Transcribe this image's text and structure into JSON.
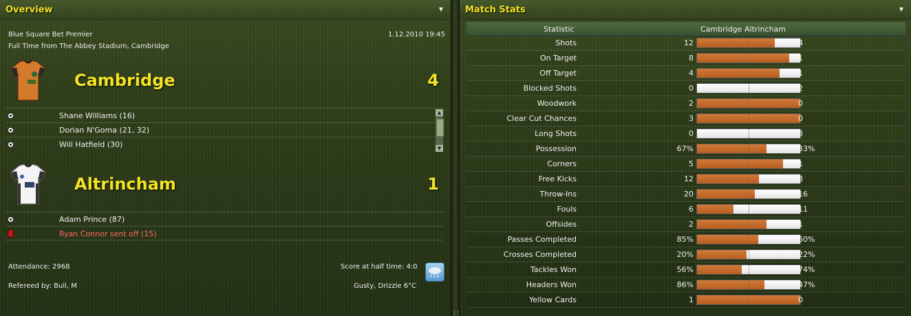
{
  "overview": {
    "title": "Overview",
    "competition": "Blue Square Bet Premier",
    "date_time": "1.12.2010 19:45",
    "venue": "Full Time from The Abbey Stadium, Cambridge",
    "home": {
      "name": "Cambridge",
      "score": "4",
      "events": [
        {
          "icon": "ball-icon",
          "text": "Shane Williams (16)"
        },
        {
          "icon": "ball-icon",
          "text": "Dorian N'Goma (21, 32)"
        },
        {
          "icon": "ball-icon",
          "text": "Will Hatfield (30)"
        }
      ]
    },
    "away": {
      "name": "Altrincham",
      "score": "1",
      "events": [
        {
          "icon": "ball-icon",
          "text": "Adam Prince (87)"
        },
        {
          "icon": "red-card-icon",
          "text": "Ryan Connor sent off (15)"
        }
      ]
    },
    "attendance": "Attendance: 2968",
    "referee": "Refereed by: Bull, M",
    "half_time": "Score at half time: 4:0",
    "weather": "Gusty, Drizzle 6°C"
  },
  "match_stats": {
    "title": "Match Stats",
    "header": {
      "statistic": "Statistic",
      "home": "Cambridge",
      "away": "Altrincham"
    },
    "colors": {
      "home": "#c26a2c",
      "away": "#f2f2f2"
    },
    "rows": [
      {
        "label": "Shots",
        "home": "12",
        "away": "4",
        "home_share": 0.75
      },
      {
        "label": "On Target",
        "home": "8",
        "away": "1",
        "home_share": 0.89
      },
      {
        "label": "Off Target",
        "home": "4",
        "away": "1",
        "home_share": 0.8
      },
      {
        "label": "Blocked Shots",
        "home": "0",
        "away": "2",
        "home_share": 0.0
      },
      {
        "label": "Woodwork",
        "home": "2",
        "away": "0",
        "home_share": 1.0
      },
      {
        "label": "Clear Cut Chances",
        "home": "3",
        "away": "0",
        "home_share": 1.0
      },
      {
        "label": "Long Shots",
        "home": "0",
        "away": "3",
        "home_share": 0.0
      },
      {
        "label": "Possession",
        "home": "67%",
        "away": "33%",
        "home_share": 0.67
      },
      {
        "label": "Corners",
        "home": "5",
        "away": "1",
        "home_share": 0.83
      },
      {
        "label": "Free Kicks",
        "home": "12",
        "away": "8",
        "home_share": 0.6
      },
      {
        "label": "Throw-Ins",
        "home": "20",
        "away": "16",
        "home_share": 0.56
      },
      {
        "label": "Fouls",
        "home": "6",
        "away": "11",
        "home_share": 0.35
      },
      {
        "label": "Offsides",
        "home": "2",
        "away": "1",
        "home_share": 0.67
      },
      {
        "label": "Passes Completed",
        "home": "85%",
        "away": "60%",
        "home_share": 0.59
      },
      {
        "label": "Crosses Completed",
        "home": "20%",
        "away": "22%",
        "home_share": 0.48
      },
      {
        "label": "Tackles Won",
        "home": "56%",
        "away": "74%",
        "home_share": 0.43
      },
      {
        "label": "Headers Won",
        "home": "86%",
        "away": "47%",
        "home_share": 0.65
      },
      {
        "label": "Yellow Cards",
        "home": "1",
        "away": "0",
        "home_share": 1.0
      }
    ]
  }
}
